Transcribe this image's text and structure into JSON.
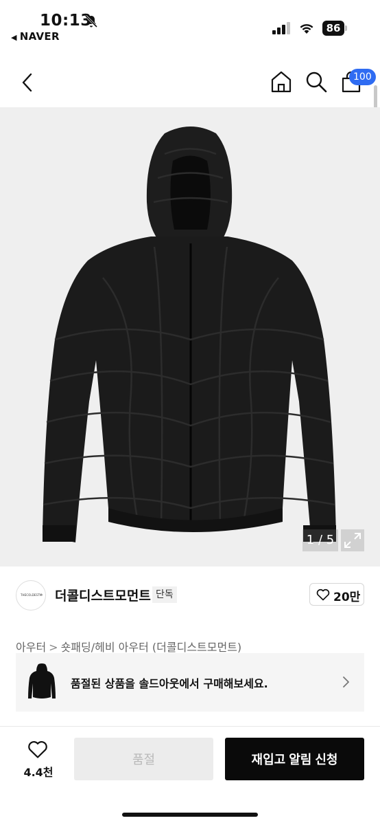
{
  "status_bar": {
    "time": "10:13",
    "back_app": "NAVER",
    "battery": "86"
  },
  "nav": {
    "cart_count": "100",
    "icons": [
      "chevron-left-icon",
      "home-icon",
      "search-icon",
      "cart-icon"
    ]
  },
  "product_image": {
    "page_indicator": "1 / 5"
  },
  "brand": {
    "name": "더콜디스트모먼트",
    "badge": "단독",
    "logo_text": "THECOLDESTMOMENT",
    "like_count": "20만"
  },
  "breadcrumb": {
    "category": "아우터",
    "separator": ">",
    "subcategory": "숏패딩/헤비 아우터",
    "brand": "(더콜디스트모먼트)"
  },
  "soldout_banner": {
    "text": "품절된 상품을 솔드아웃에서 구매해보세요."
  },
  "bottom_bar": {
    "like_count": "4.4천",
    "soldout_label": "품절",
    "restock_label": "재입고 알림 신청"
  },
  "colors": {
    "badge_blue": "#2f6cf2",
    "cta_black": "#0a0a0a",
    "disabled_gray": "#ececec"
  }
}
